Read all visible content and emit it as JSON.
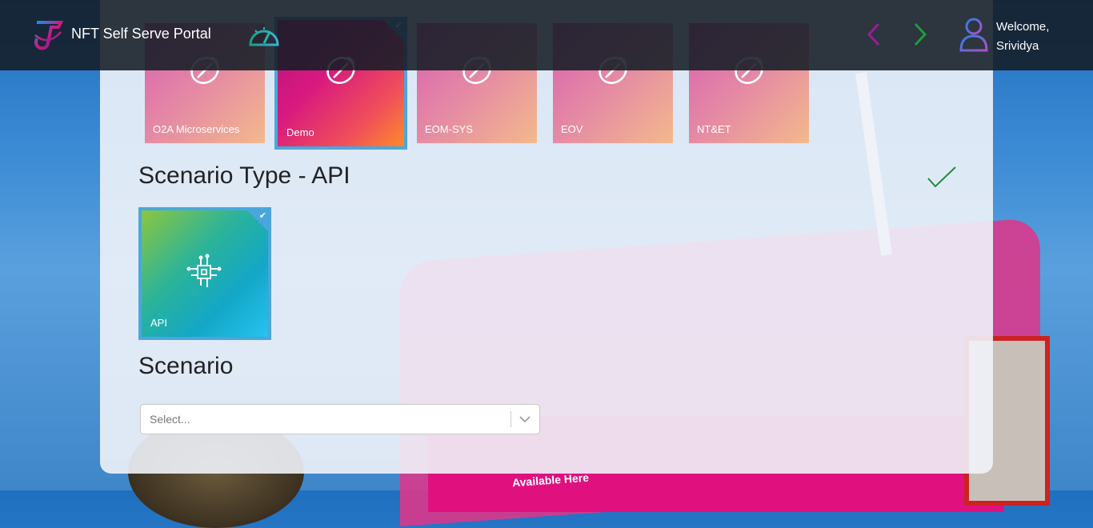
{
  "header": {
    "title": "NFT Self Serve Portal",
    "welcome_line1": "Welcome,",
    "welcome_line2": "Srividya",
    "icons": [
      "telstra-logo-icon",
      "speed-gauge-icon",
      "chevron-left-icon",
      "chevron-right-icon",
      "user-icon"
    ]
  },
  "applications": {
    "tiles": [
      {
        "label": "O2A Microservices",
        "selected": false
      },
      {
        "label": "Demo",
        "selected": true
      },
      {
        "label": "EOM-SYS",
        "selected": false
      },
      {
        "label": "EOV",
        "selected": false
      },
      {
        "label": "NT&ET",
        "selected": false
      }
    ]
  },
  "scenario_type": {
    "title": "Scenario Type - API",
    "tiles": [
      {
        "label": "API",
        "selected": true
      }
    ]
  },
  "scenario": {
    "title": "Scenario",
    "select_placeholder": "Select..."
  },
  "background": {
    "sign_text": "Available Here"
  },
  "colors": {
    "accent_blue": "#4aa7de",
    "nav_prev": "#a0199a",
    "nav_next": "#1f9c3a",
    "check": "#1f8a3a"
  }
}
